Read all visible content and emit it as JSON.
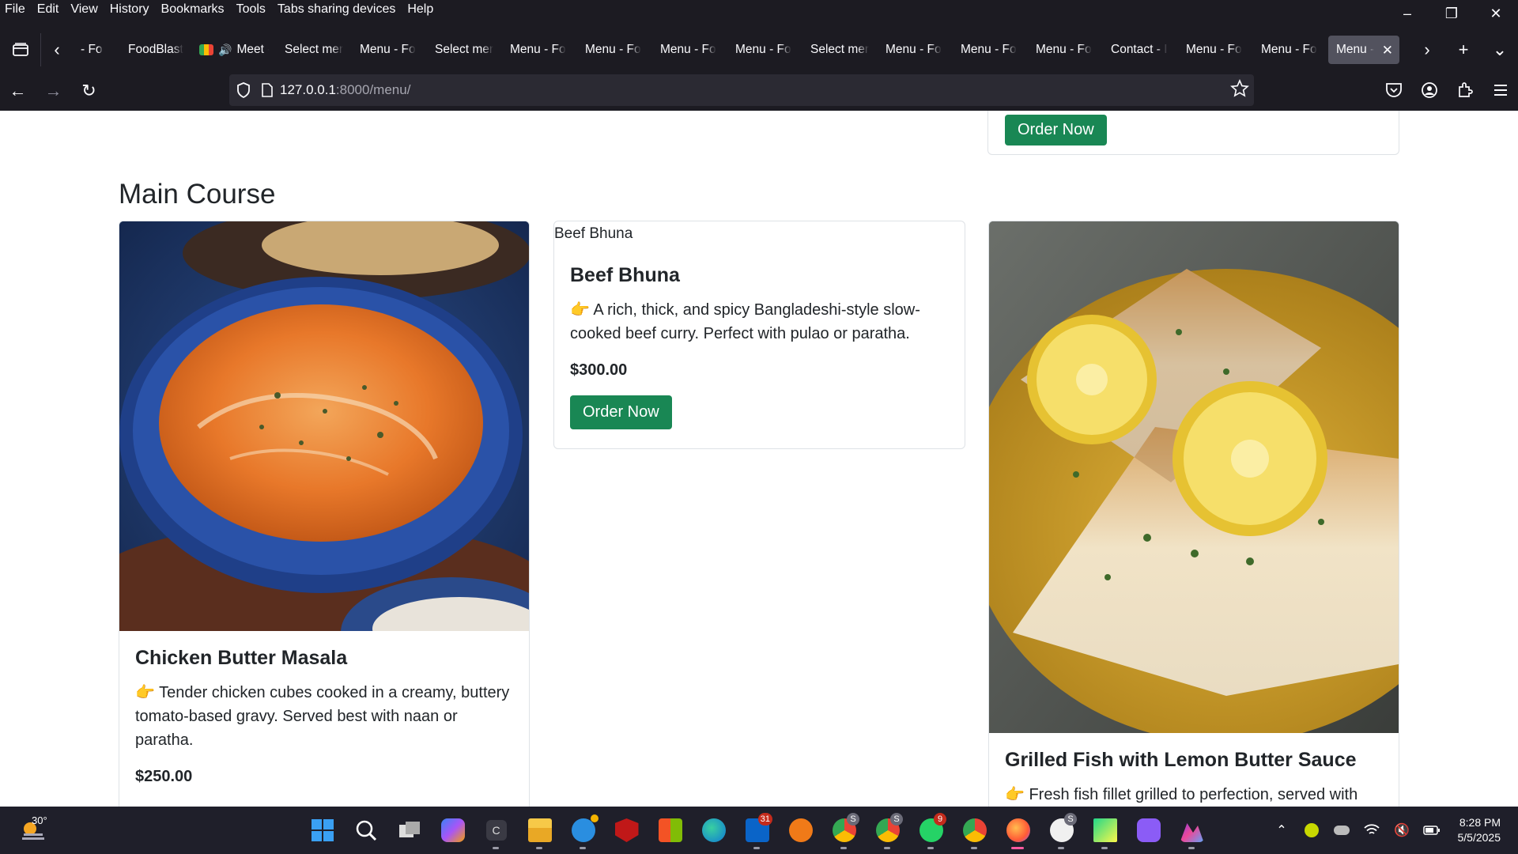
{
  "menubar": {
    "items": [
      "File",
      "Edit",
      "View",
      "History",
      "Bookmarks",
      "Tools",
      "Tabs sharing devices",
      "Help"
    ]
  },
  "tabs": [
    {
      "label": "- Fo"
    },
    {
      "label": "FoodBlast"
    },
    {
      "label": "Meet -"
    },
    {
      "label": "Select mer"
    },
    {
      "label": "Menu - Fo"
    },
    {
      "label": "Select mer"
    },
    {
      "label": "Menu - Fo"
    },
    {
      "label": "Menu - Fo"
    },
    {
      "label": "Menu - Fo"
    },
    {
      "label": "Menu - Fo"
    },
    {
      "label": "Select mer"
    },
    {
      "label": "Menu - Fo"
    },
    {
      "label": "Menu - Fo"
    },
    {
      "label": "Menu - Fo"
    },
    {
      "label": "Contact - I"
    },
    {
      "label": "Menu - Fo"
    },
    {
      "label": "Menu - Fo"
    },
    {
      "label": "Menu -"
    }
  ],
  "address": {
    "host": "127.0.0.1",
    "path": ":8000/menu/"
  },
  "page": {
    "top_card": {
      "button": "Order Now"
    },
    "section_title": "Main Course",
    "items": [
      {
        "title": "Chicken Butter Masala",
        "description": "👉 Tender chicken cubes cooked in a creamy, buttery tomato-based gravy. Served best with naan or paratha.",
        "price": "$250.00",
        "image": "chicken-butter-masala-photo"
      },
      {
        "image_alt": "Beef Bhuna",
        "title": "Beef Bhuna",
        "description": "👉 A rich, thick, and spicy Bangladeshi-style slow-cooked beef curry. Perfect with pulao or paratha.",
        "price": "$300.00",
        "button": "Order Now"
      },
      {
        "title": "Grilled Fish with Lemon Butter Sauce",
        "description": "👉 Fresh fish fillet grilled to perfection, served with",
        "image": "grilled-fish-photo"
      }
    ]
  },
  "taskbar": {
    "temperature": "30°",
    "badges": {
      "mail": "31",
      "chrome1": "S",
      "chrome2": "S",
      "whatsapp": "9",
      "github": "S"
    },
    "time": "8:28 PM",
    "date": "5/5/2025"
  },
  "colors": {
    "chrome_bg": "#1c1b22",
    "urlbar_bg": "#2b2a33",
    "active_tab": "#52525e",
    "accent_green": "#198754",
    "taskbar_bg": "#1f1f2a"
  }
}
